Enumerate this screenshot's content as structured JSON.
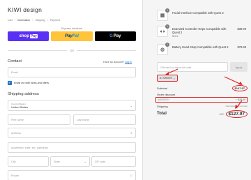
{
  "store": {
    "name": "KIWI design"
  },
  "breadcrumb": {
    "cart": "Cart",
    "information": "Information",
    "shipping": "Shipping",
    "payment": "Payment",
    "separator": "›"
  },
  "express_checkout": {
    "label": "Express checkout",
    "shop_pay": "shop",
    "shop_pay_box": "Pay",
    "paypal_a": "Pay",
    "paypal_b": "Pal",
    "gpay_g": "G",
    "gpay_text": "Pay",
    "or": "OR"
  },
  "contact": {
    "title": "Contact",
    "have_account": "Have an account?",
    "login": "Log in",
    "email_placeholder": "Email",
    "newsletter_label": "Email me with news and offers",
    "newsletter_checked": true
  },
  "shipping_address": {
    "title": "Shipping address",
    "country_label": "Country/Region",
    "country_value": "United States",
    "first_name": "First name",
    "last_name": "Last name",
    "address": "Address",
    "apartment": "Apartment, suite, etc. (optional)",
    "city": "City",
    "state": "State",
    "zip": "ZIP code",
    "phone": "Phone"
  },
  "cart_items": [
    {
      "name": "Facial Interface Compatible with Quest 2",
      "variant": "",
      "price": "",
      "quantity": "1"
    },
    {
      "name": "Extended Controller Grips Compatible with Quest 2",
      "variant": "Black",
      "price": "$39.99",
      "quantity": "1"
    },
    {
      "name": "Battery Head Strap Compatible with Quest 2",
      "variant": "",
      "price": "$79.99",
      "quantity": "1"
    }
  ],
  "discount": {
    "placeholder": "Gift card or discount code",
    "apply_label": "Apply",
    "applied_code": "KWISTH",
    "remove_icon": "×"
  },
  "summary": {
    "subtotal_label": "Subtotal",
    "subtotal_value": "$147.97",
    "order_discount_label": "Order discount",
    "code_name": "KWISTH",
    "code_value": "− $20.00",
    "shipping_label": "Shipping",
    "shipping_value": "Calculated at next step",
    "total_label": "Total",
    "currency": "USD",
    "total_value": "$127.97"
  },
  "colors": {
    "shop_pay": "#5a31f4",
    "paypal": "#ffc439",
    "gpay": "#000000",
    "link": "#1f75cb",
    "annotation": "#e02020"
  }
}
